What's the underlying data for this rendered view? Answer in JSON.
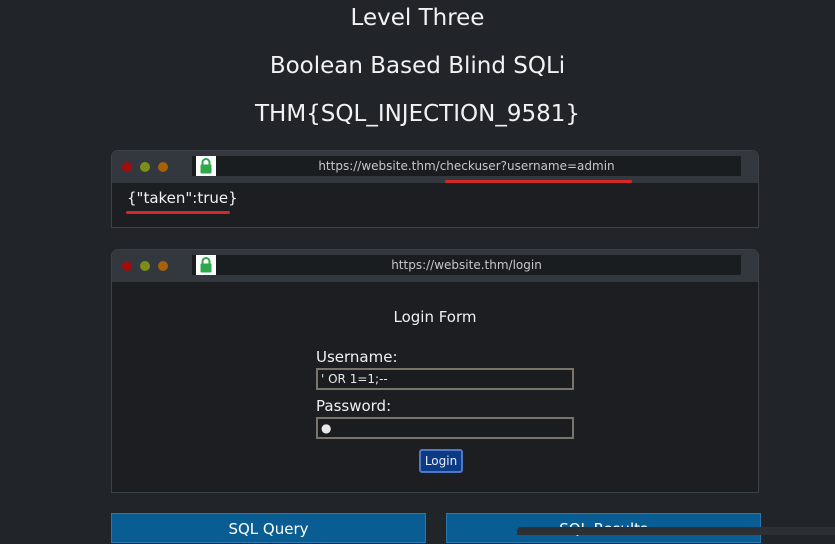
{
  "page": {
    "level_title": "Level Three",
    "level_subtitle": "Boolean Based Blind SQLi",
    "flag": "THM{SQL_INJECTION_9581}"
  },
  "colors": {
    "background": "#212529",
    "browser_bar": "#32383e",
    "red_underline": "#d5282a",
    "login_button": "#0d3a85",
    "panel_button": "#0a5d92",
    "lock_green": "#2ea84a"
  },
  "browser_check": {
    "url": "https://website.thm/checkuser?username=admin",
    "lock_icon": "lock-icon",
    "response": "{\"taken\":true}"
  },
  "browser_login": {
    "url": "https://website.thm/login",
    "lock_icon": "lock-icon",
    "form": {
      "title": "Login Form",
      "username_label": "Username:",
      "username_value": "' OR 1=1;--",
      "password_label": "Password:",
      "password_value": "●",
      "login_button": "Login"
    }
  },
  "panels": {
    "sql_query": "SQL Query",
    "sql_results": "SQL Results"
  }
}
